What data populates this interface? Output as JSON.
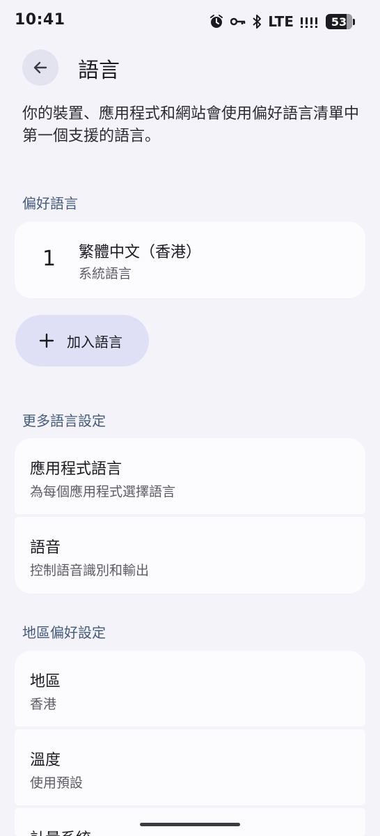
{
  "status_bar": {
    "time": "10:41",
    "network": "LTE",
    "battery": "53",
    "icons": [
      "alarm-icon",
      "vpn-key-icon",
      "bluetooth-icon",
      "signal-icon",
      "battery-icon"
    ]
  },
  "header": {
    "back_icon": "arrow-back-icon",
    "title": "語言"
  },
  "description": "你的裝置、應用程式和網站會使用偏好語言清單中第一個支援的語言。",
  "preferred": {
    "header": "偏好語言",
    "languages": [
      {
        "number": "1",
        "name": "繁體中文（香港）",
        "subtitle": "系統語言"
      }
    ],
    "add_button": {
      "icon": "plus-icon",
      "label": "加入語言"
    }
  },
  "more_settings": {
    "header": "更多語言設定",
    "items": [
      {
        "title": "應用程式語言",
        "subtitle": "為每個應用程式選擇語言"
      },
      {
        "title": "語音",
        "subtitle": "控制語音識別和輸出"
      }
    ]
  },
  "region_prefs": {
    "header": "地區偏好設定",
    "items": [
      {
        "title": "地區",
        "subtitle": "香港"
      },
      {
        "title": "溫度",
        "subtitle": "使用預設"
      },
      {
        "title": "計量系統",
        "subtitle": ""
      }
    ]
  },
  "colors": {
    "background": "#f3f3f9",
    "card": "#fcfcff",
    "section_header": "#445a7e",
    "add_button_bg": "#dfe0f6"
  }
}
